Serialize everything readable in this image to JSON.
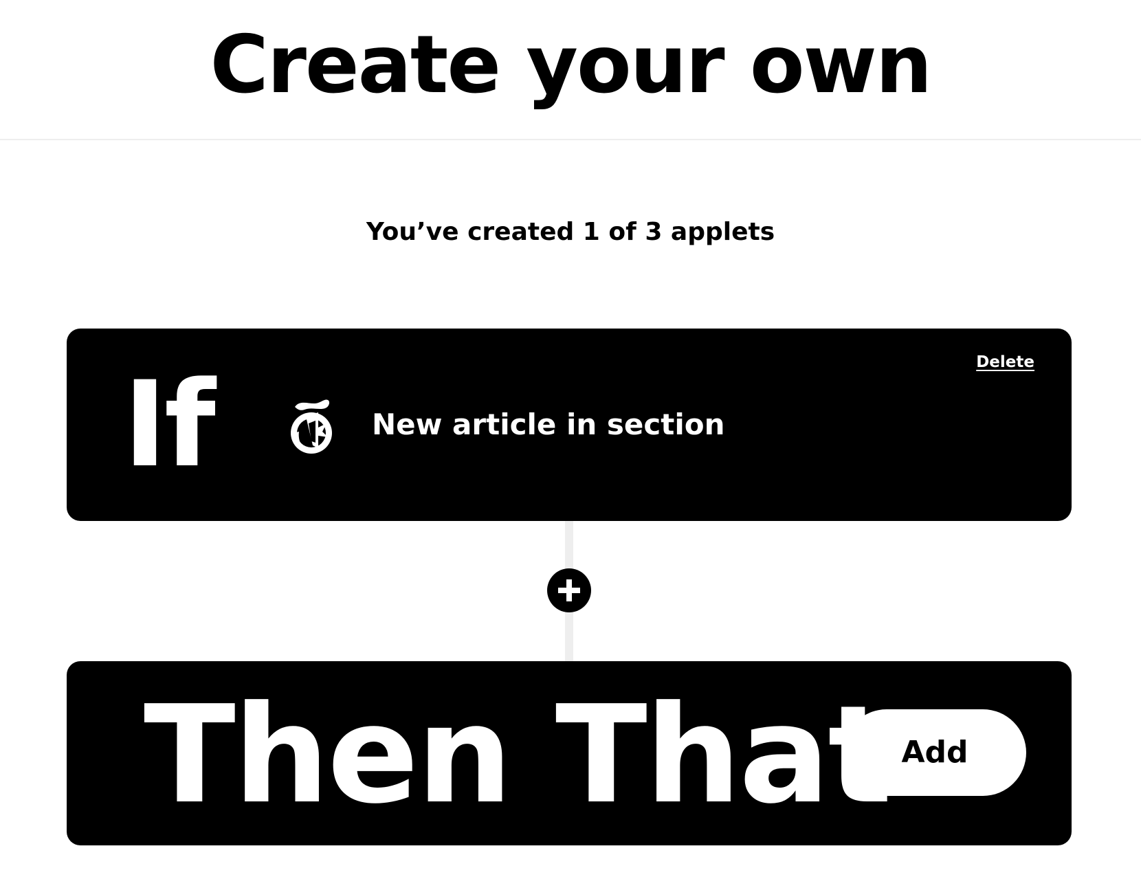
{
  "header": {
    "title": "Create your own"
  },
  "status": {
    "applet_count_text": "You’ve created 1 of 3 applets"
  },
  "if_block": {
    "keyword": "If",
    "service_icon": "nytimes-logo-icon",
    "trigger_label": "New article in section",
    "delete_label": "Delete"
  },
  "connector": {
    "add_step_icon": "plus-icon"
  },
  "then_block": {
    "keyword": "Then That",
    "add_label": "Add"
  },
  "colors": {
    "background": "#ffffff",
    "card": "#000000",
    "card_text": "#ffffff",
    "connector": "#eeeeee"
  }
}
